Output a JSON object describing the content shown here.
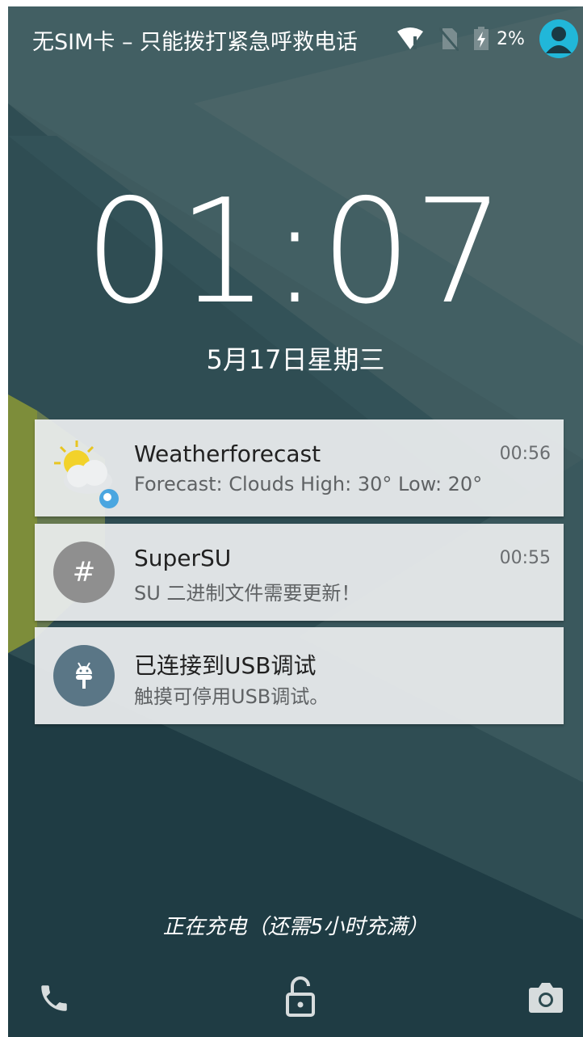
{
  "status_bar": {
    "carrier_text": "无SIM卡 – 只能拨打紧急呼救电话",
    "battery_percent": "2%",
    "icons": [
      "wifi-alert-icon",
      "no-sim-icon",
      "battery-charging-icon",
      "user-avatar-icon"
    ]
  },
  "lockscreen": {
    "time": "01:07",
    "date": "5月17日星期三",
    "charging_status": "正在充电（还需5小时充满）"
  },
  "notifications": [
    {
      "app": "Weatherforecast",
      "body": "Forecast: Clouds High: 30° Low: 20°",
      "time": "00:56",
      "icon": "weather-sun-cloud-icon"
    },
    {
      "app": "SuperSU",
      "body": "SU 二进制文件需要更新！",
      "time": "00:55",
      "icon": "hash-icon",
      "icon_color": "#8f8f8f"
    },
    {
      "app": "已连接到USB调试",
      "body": "触摸可停用USB调试。",
      "time": "",
      "icon": "android-debug-icon",
      "icon_color": "#5a7686"
    }
  ],
  "bottom_actions": [
    "phone-icon",
    "unlock-icon",
    "camera-icon"
  ],
  "colors": {
    "wallpaper_base": "#3e5a5e",
    "avatar": "#21b7d9",
    "card_bg": "#eceeef"
  }
}
